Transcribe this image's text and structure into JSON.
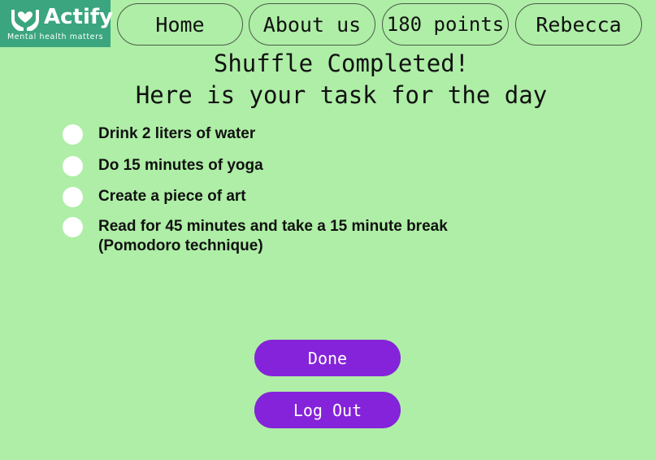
{
  "logo": {
    "name": "Actify",
    "tagline": "Mental health matters"
  },
  "nav": {
    "home": "Home",
    "about": "About us",
    "points": "180 points",
    "user": "Rebecca"
  },
  "heading": {
    "line1": "Shuffle Completed!",
    "line2": "Here is your task for the day"
  },
  "tasks": [
    {
      "label": "Drink 2 liters of water"
    },
    {
      "label": "Do 15 minutes of yoga"
    },
    {
      "label": "Create a piece of art"
    },
    {
      "label": "Read for 45 minutes and take a 15 minute break (Pomodoro technique)"
    }
  ],
  "buttons": {
    "done": "Done",
    "logout": "Log Out"
  },
  "colors": {
    "background": "#aeeea6",
    "logo_background": "#3aa57f",
    "button": "#8423d9",
    "radio": "#ffffff"
  },
  "icons": {
    "logo": "hands-holding-heart-icon"
  }
}
